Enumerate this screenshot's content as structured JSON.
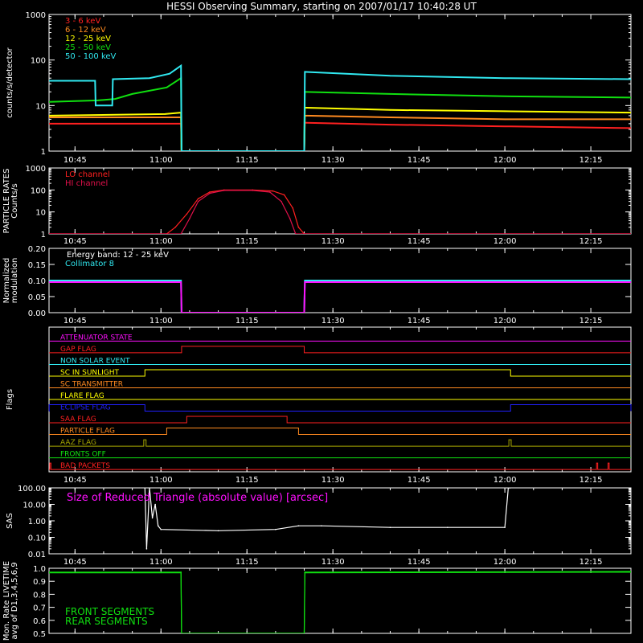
{
  "title": "HESSI Observing Summary, starting on 2007/01/17 10:40:28 UT",
  "time_axis": {
    "tick_labels": [
      "10:45",
      "11:00",
      "11:15",
      "11:30",
      "11:45",
      "12:00",
      "12:15"
    ],
    "tick_minutes": [
      645,
      660,
      675,
      690,
      705,
      720,
      735
    ],
    "range_minutes": [
      640.47,
      742.0
    ]
  },
  "colors": {
    "axis": "#ffffff",
    "red": "#ff2020",
    "orange": "#ff8a20",
    "yellow": "#ffff00",
    "green": "#10e010",
    "cyan": "#30e8f0",
    "magenta": "#ff10ff",
    "blue": "#2020ff",
    "crimson": "#e0104a",
    "olive": "#a8a800",
    "brown": "#c05020"
  },
  "chart_data": [
    {
      "type": "line",
      "ylabel": "counts/s/detector",
      "scale": "log",
      "ylim": [
        1,
        1000
      ],
      "ytick_labels": [
        "1",
        "10",
        "100",
        "1000"
      ],
      "legend_position": "top-left",
      "series": [
        {
          "name": "3 - 6 keV",
          "color": "red",
          "points": [
            [
              640.5,
              4
            ],
            [
              660.7,
              4
            ],
            [
              663.5,
              4
            ],
            [
              663.6,
              1
            ],
            [
              685.0,
              1
            ],
            [
              685.1,
              4.2
            ],
            [
              700,
              3.8
            ],
            [
              720,
              3.5
            ],
            [
              742,
              3.2
            ]
          ]
        },
        {
          "name": "6 - 12 keV",
          "color": "orange",
          "points": [
            [
              640.5,
              5.5
            ],
            [
              660.7,
              5.5
            ],
            [
              663.5,
              5.5
            ],
            [
              663.6,
              1
            ],
            [
              685.0,
              1
            ],
            [
              685.1,
              6
            ],
            [
              700,
              5.5
            ],
            [
              720,
              5
            ],
            [
              742,
              5
            ]
          ]
        },
        {
          "name": "12 - 25 keV",
          "color": "yellow",
          "points": [
            [
              640.5,
              6
            ],
            [
              660.7,
              6.5
            ],
            [
              663.5,
              7
            ],
            [
              663.6,
              1
            ],
            [
              685.0,
              1
            ],
            [
              685.1,
              9
            ],
            [
              700,
              8
            ],
            [
              720,
              7.5
            ],
            [
              742,
              7
            ]
          ]
        },
        {
          "name": "25 - 50 keV",
          "color": "green",
          "points": [
            [
              640.5,
              12
            ],
            [
              649.0,
              13
            ],
            [
              652.0,
              14
            ],
            [
              655.0,
              18
            ],
            [
              661.0,
              25
            ],
            [
              663.5,
              40
            ],
            [
              663.6,
              1
            ],
            [
              685.0,
              1
            ],
            [
              685.1,
              20
            ],
            [
              700,
              18
            ],
            [
              720,
              16
            ],
            [
              742,
              15
            ]
          ]
        },
        {
          "name": "50 - 100 keV",
          "color": "cyan",
          "points": [
            [
              640.5,
              35
            ],
            [
              648.5,
              35
            ],
            [
              648.6,
              10
            ],
            [
              651.5,
              10
            ],
            [
              651.6,
              38
            ],
            [
              658.0,
              40
            ],
            [
              661.5,
              50
            ],
            [
              663.5,
              75
            ],
            [
              663.6,
              1
            ],
            [
              685.0,
              1
            ],
            [
              685.1,
              55
            ],
            [
              700,
              45
            ],
            [
              720,
              40
            ],
            [
              742,
              38
            ]
          ]
        }
      ]
    },
    {
      "type": "line",
      "ylabel": "PARTICLE RATES Counts/s",
      "scale": "log",
      "ylim": [
        1,
        1000
      ],
      "ytick_labels": [
        "1",
        "10",
        "100",
        "1000"
      ],
      "legend_position": "top-left",
      "series": [
        {
          "name": "LO channel",
          "color": "red",
          "points": [
            [
              640.5,
              1
            ],
            [
              661.0,
              1
            ],
            [
              662.5,
              2
            ],
            [
              664.5,
              8
            ],
            [
              666.5,
              40
            ],
            [
              668.5,
              80
            ],
            [
              671.0,
              100
            ],
            [
              676.0,
              100
            ],
            [
              679.5,
              90
            ],
            [
              681.5,
              60
            ],
            [
              683.0,
              15
            ],
            [
              684.0,
              2
            ],
            [
              685.0,
              1
            ],
            [
              742,
              1
            ]
          ]
        },
        {
          "name": "HI channel",
          "color": "crimson",
          "points": [
            [
              640.5,
              1
            ],
            [
              663.5,
              1
            ],
            [
              665.0,
              5
            ],
            [
              666.5,
              30
            ],
            [
              668.5,
              70
            ],
            [
              671.0,
              95
            ],
            [
              676.0,
              95
            ],
            [
              679.0,
              80
            ],
            [
              681.0,
              30
            ],
            [
              682.5,
              5
            ],
            [
              683.5,
              1
            ],
            [
              742,
              1
            ]
          ]
        }
      ]
    },
    {
      "type": "line",
      "ylabel": "Normalized modulation",
      "scale": "linear",
      "ylim": [
        0,
        0.2
      ],
      "ytick_labels": [
        "0.00",
        "0.05",
        "0.10",
        "0.15",
        "0.20"
      ],
      "legend_position": "top-left",
      "annotation": "Energy band: 12 - 25 keV",
      "series": [
        {
          "name": "Collimator 8",
          "color": "cyan",
          "points": [
            [
              640.5,
              0.1
            ],
            [
              663.5,
              0.1
            ],
            [
              663.6,
              0.0
            ],
            [
              685.0,
              0.0
            ],
            [
              685.1,
              0.1
            ],
            [
              742,
              0.1
            ]
          ]
        },
        {
          "name": "",
          "color": "magenta",
          "points": [
            [
              640.5,
              0.095
            ],
            [
              663.5,
              0.095
            ],
            [
              663.6,
              0.0
            ],
            [
              685.0,
              0.0
            ],
            [
              685.1,
              0.095
            ],
            [
              742,
              0.095
            ]
          ]
        }
      ]
    },
    {
      "type": "line",
      "ylabel": "Flags",
      "flags": [
        {
          "label": "ATTENUATOR STATE",
          "color": "magenta",
          "on": []
        },
        {
          "label": "GAP FLAG",
          "color": "red",
          "on": [
            [
              663.6,
              685.0
            ]
          ]
        },
        {
          "label": "NON SOLAR EVENT",
          "color": "cyan",
          "on": []
        },
        {
          "label": "SC IN SUNLIGHT",
          "color": "yellow",
          "on": [
            [
              657.2,
              721.0
            ]
          ]
        },
        {
          "label": "SC TRANSMITTER",
          "color": "orange",
          "on": []
        },
        {
          "label": "FLARE FLAG",
          "color": "yellow",
          "on": []
        },
        {
          "label": "ECLIPSE FLAG",
          "color": "blue",
          "on": [
            [
              640.5,
              657.2
            ],
            [
              721.0,
              742.0
            ]
          ]
        },
        {
          "label": "SAA FLAG",
          "color": "red",
          "on": [
            [
              664.5,
              682.0
            ]
          ]
        },
        {
          "label": "PARTICLE FLAG",
          "color": "orange",
          "on": [
            [
              661.0,
              684.0
            ]
          ]
        },
        {
          "label": "AAZ FLAG",
          "color": "olive",
          "on": [
            [
              657.0,
              657.4
            ],
            [
              720.7,
              721.1
            ]
          ]
        },
        {
          "label": "FRONTS OFF",
          "color": "green",
          "on": []
        },
        {
          "label": "BAD PACKETS",
          "color": "red",
          "on": [
            [
              640.6,
              640.8
            ],
            [
              736.0,
              736.2
            ],
            [
              738.0,
              738.2
            ]
          ]
        }
      ]
    },
    {
      "type": "line",
      "ylabel": "SAS",
      "scale": "log",
      "ylim": [
        0.01,
        100
      ],
      "ytick_labels": [
        "0.01",
        "0.10",
        "1.00",
        "10.00",
        "100.00"
      ],
      "legend_position": "top-left",
      "annotation": "Size of Reduced Triangle (absolute value) [arcsec]",
      "series": [
        {
          "name": "",
          "color": "axis",
          "points": [
            [
              657.2,
              100
            ],
            [
              657.5,
              0.02
            ],
            [
              658.0,
              100
            ],
            [
              658.5,
              1.5
            ],
            [
              659.0,
              10
            ],
            [
              659.5,
              0.5
            ],
            [
              660,
              0.3
            ],
            [
              670,
              0.25
            ],
            [
              680,
              0.3
            ],
            [
              684,
              0.5
            ],
            [
              688,
              0.5
            ],
            [
              700,
              0.4
            ],
            [
              710,
              0.4
            ],
            [
              720,
              0.4
            ],
            [
              720.6,
              100
            ],
            [
              720.9,
              100
            ]
          ]
        }
      ]
    },
    {
      "type": "line",
      "ylabel": "Mon. Rate LIVETIME avg of D1,3,4,5,6,9",
      "scale": "linear",
      "ylim": [
        0.5,
        1.0
      ],
      "ytick_labels": [
        "0.5",
        "0.6",
        "0.7",
        "0.8",
        "0.9",
        "1.0"
      ],
      "legend_position": "bottom-left",
      "series": [
        {
          "name": "FRONT SEGMENTS",
          "color": "green",
          "points": [
            [
              640.5,
              0.97
            ],
            [
              663.5,
              0.97
            ],
            [
              663.6,
              0.5
            ],
            [
              685.0,
              0.5
            ],
            [
              685.1,
              0.97
            ],
            [
              742,
              0.975
            ]
          ]
        },
        {
          "name": "REAR SEGMENTS",
          "color": "green",
          "points": [
            [
              640.5,
              0.965
            ],
            [
              663.5,
              0.965
            ],
            [
              663.6,
              0.5
            ],
            [
              685.0,
              0.5
            ],
            [
              685.1,
              0.965
            ],
            [
              742,
              0.97
            ]
          ]
        }
      ]
    }
  ]
}
